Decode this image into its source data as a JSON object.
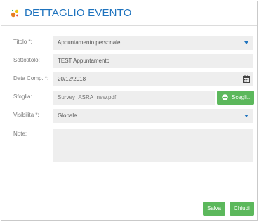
{
  "header": {
    "title": "DETTAGLIO EVENTO",
    "icon": "sparkle-icon"
  },
  "form": {
    "titolo": {
      "label": "Titolo *:",
      "value": "Appuntamento personale"
    },
    "sottotitolo": {
      "label": "Sottotitolo:",
      "value": "TEST Appuntamento"
    },
    "data_comp": {
      "label": "Data Comp. *:",
      "value": "20/12/2018"
    },
    "sfoglia": {
      "label": "Sfoglia:",
      "value": "Survey_ASRA_new.pdf",
      "button": "Scegli..."
    },
    "visibilita": {
      "label": "Visibilita *:",
      "value": "Globale"
    },
    "note": {
      "label": "Note:",
      "value": ""
    }
  },
  "footer": {
    "save": "Salva",
    "close": "Chiudi"
  },
  "colors": {
    "accent": "#1e73be",
    "success": "#5cb85c",
    "field": "#eeeeee"
  }
}
